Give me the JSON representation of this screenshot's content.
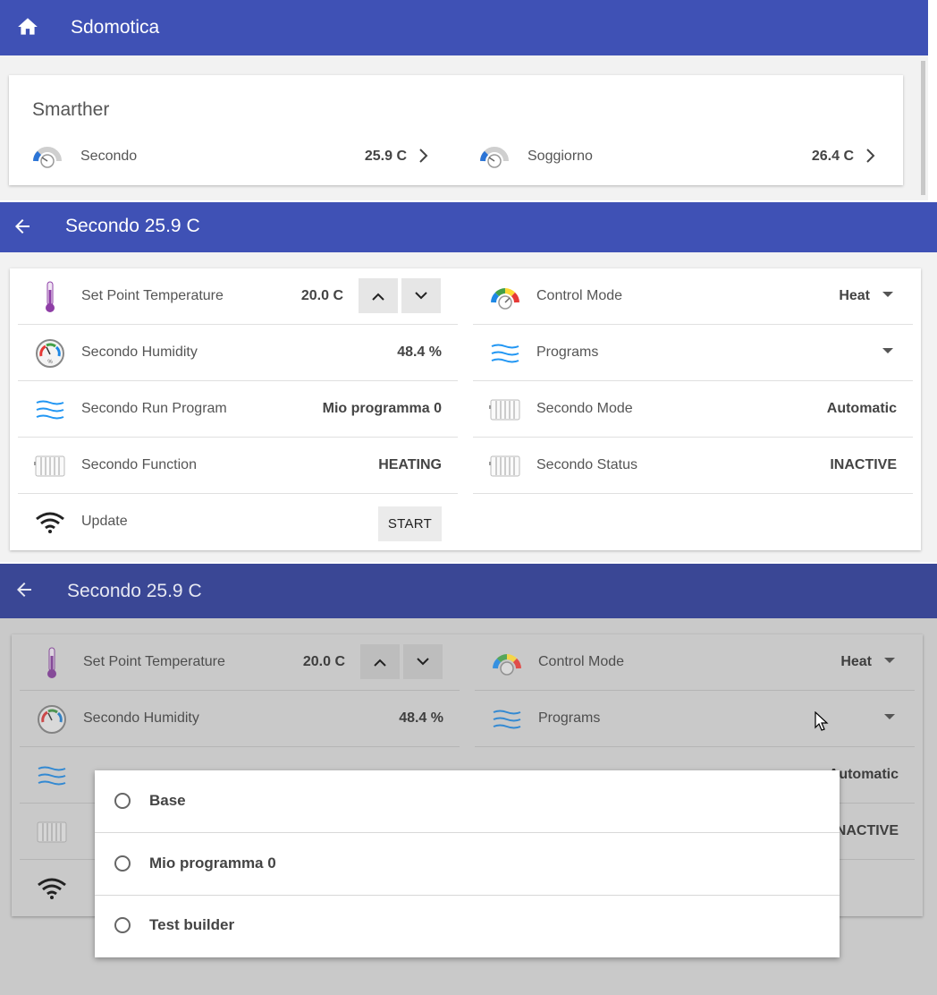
{
  "app": {
    "title": "Sdomotica",
    "icon": "home-icon"
  },
  "smarther": {
    "title": "Smarther",
    "devices": [
      {
        "name": "Secondo",
        "value": "25.9 C",
        "icon": "thermostat-gauge-icon"
      },
      {
        "name": "Soggiorno",
        "value": "26.4 C",
        "icon": "thermostat-gauge-icon"
      }
    ]
  },
  "detail": {
    "title": "Secondo 25.9 C",
    "back_icon": "back-arrow-icon",
    "left_rows": [
      {
        "label": "Set Point Temperature",
        "value": "20.0 C",
        "icon": "thermometer-icon"
      },
      {
        "label": "Secondo Humidity",
        "value": "48.4 %",
        "icon": "hygrometer-icon"
      },
      {
        "label": "Secondo Run Program",
        "value": "Mio programma 0",
        "icon": "waves-icon"
      },
      {
        "label": "Secondo Function",
        "value": "HEATING",
        "icon": "radiator-icon"
      },
      {
        "label": "Update",
        "button": "START",
        "icon": "wifi-icon"
      }
    ],
    "right_rows": [
      {
        "label": "Control Mode",
        "value": "Heat",
        "icon": "mode-gauge-icon"
      },
      {
        "label": "Programs",
        "value": "",
        "icon": "waves-icon"
      },
      {
        "label": "Secondo Mode",
        "value": "Automatic",
        "icon": "radiator-icon"
      },
      {
        "label": "Secondo Status",
        "value": "INACTIVE",
        "icon": "radiator-icon"
      }
    ]
  },
  "programs_popup": {
    "options": [
      "Base",
      "Mio programma 0",
      "Test builder"
    ]
  },
  "colors": {
    "primary": "#3f51b5",
    "primary_dim": "#3a4795",
    "accent_blue": "#2196f3",
    "thermometer": "#8e3ea6"
  }
}
